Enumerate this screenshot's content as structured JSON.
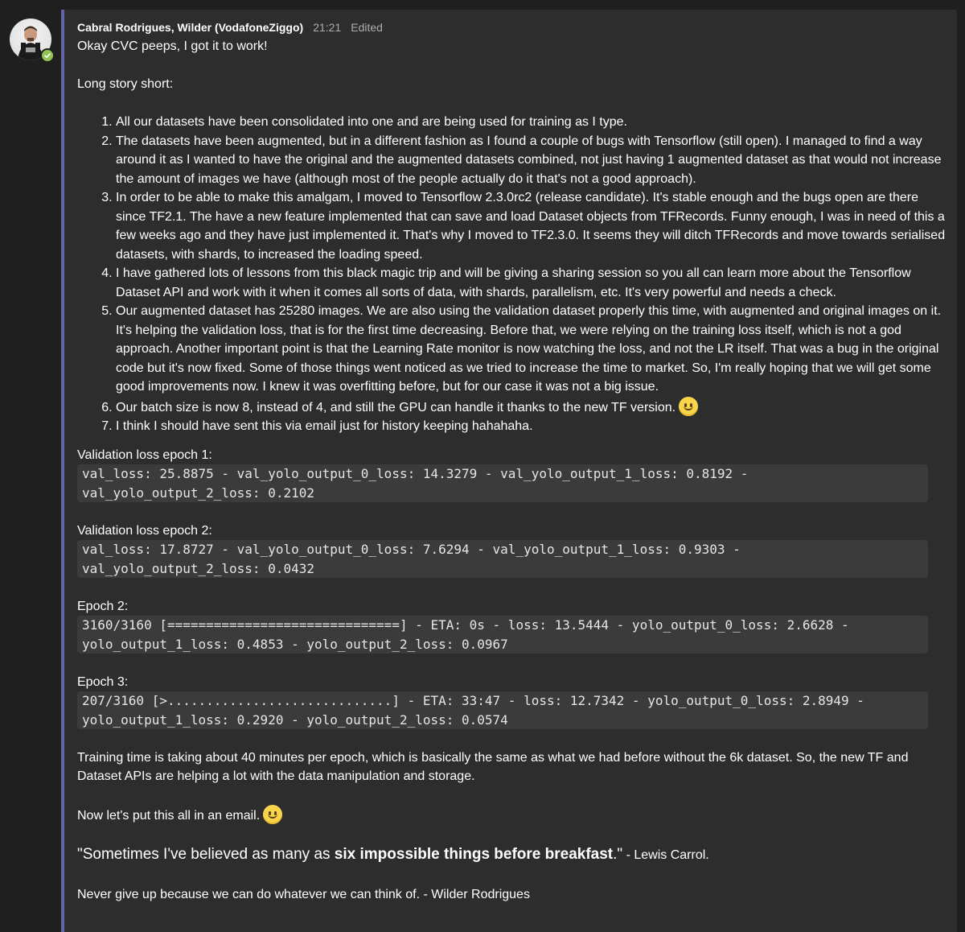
{
  "avatar": {
    "icon": "user-avatar",
    "presence": "available",
    "presence_color": "#92c353"
  },
  "accent_color": "#6264a7",
  "message": {
    "author": "Cabral Rodrigues, Wilder (VodafoneZiggo)",
    "time": "21:21",
    "edited": "Edited",
    "intro": "Okay CVC peeps, I got it to work!",
    "long_story": "Long story short:",
    "points": [
      "All our datasets have been consolidated into one and are being used for training as I type.",
      "The datasets have been augmented, but in a different fashion as I found a couple of bugs with Tensorflow (still open). I managed to find a way around it as I wanted to have the original and the augmented datasets combined, not just having 1 augmented dataset as that would not increase the amount of images we have (although most of the people actually do it that's not a good approach).",
      "In order to be able to make this amalgam, I moved to Tensorflow 2.3.0rc2 (release candidate). It's stable enough and the bugs open are there since TF2.1. The have a new feature implemented that can save and load Dataset objects from TFRecords. Funny enough, I was in need of this a few weeks ago and they have just implemented it. That's why I moved to TF2.3.0. It seems they will ditch TFRecords and move towards serialised datasets, with shards, to increased the loading speed.",
      "I have gathered lots of lessons from this black magic trip and will be giving a sharing session so you all can learn more about the Tensorflow Dataset API and work with it when it comes all sorts of data, with shards, parallelism, etc. It's very powerful and needs a check.",
      "Our augmented dataset has 25280 images. We are also using the validation dataset properly this time, with augmented and original images on it. It's helping the validation loss, that is for the first time decreasing. Before that, we were relying on the training loss itself, which is not a god approach. Another important point is that the Learning Rate monitor is now watching the loss, and not the LR itself. That was a bug in the original code but it's now fixed. Some of those things went noticed as we tried to increase the time to market. So, I'm really hoping that we will get some good improvements now. I knew it was overfitting before, but for our case it was not a big issue.",
      "Our batch size is now 8, instead of 4, and still the GPU can handle it thanks to the new TF version.",
      "I think I should have sent this via email just for history keeping hahahaha."
    ],
    "blocks": [
      {
        "label": "Validation loss epoch 1:",
        "code": "val_loss: 25.8875 - val_yolo_output_0_loss: 14.3279 - val_yolo_output_1_loss: 0.8192 - val_yolo_output_2_loss: 0.2102"
      },
      {
        "label": "Validation loss epoch 2:",
        "code": "val_loss: 17.8727 - val_yolo_output_0_loss: 7.6294 - val_yolo_output_1_loss: 0.9303 - val_yolo_output_2_loss: 0.0432"
      },
      {
        "label": "Epoch 2:",
        "code": "3160/3160 [==============================] - ETA: 0s - loss: 13.5444 - yolo_output_0_loss: 2.6628 - yolo_output_1_loss: 0.4853 - yolo_output_2_loss: 0.0967"
      },
      {
        "label": "Epoch 3:",
        "code": "207/3160 [>.............................] - ETA: 33:47 - loss: 12.7342 - yolo_output_0_loss: 2.8949 - yolo_output_1_loss: 0.2920 - yolo_output_2_loss: 0.0574"
      }
    ],
    "training_time": "Training time is taking about 40 minutes per epoch, which is basically the same as what we had before without the 6k dataset. So, the new TF and Dataset APIs are helping a lot with the data manipulation and storage.",
    "email_note": "Now let's put this all in an email.",
    "quote_open": "\"Sometimes I've believed as many as ",
    "quote_bold": "six impossible things before breakfast",
    "quote_close": ".\"",
    "quote_author": " - Lewis Carrol.",
    "closing": "Never give up because we can do whatever we can think of. - Wilder Rodrigues",
    "emoji_name": "smiling-face-emoji"
  }
}
